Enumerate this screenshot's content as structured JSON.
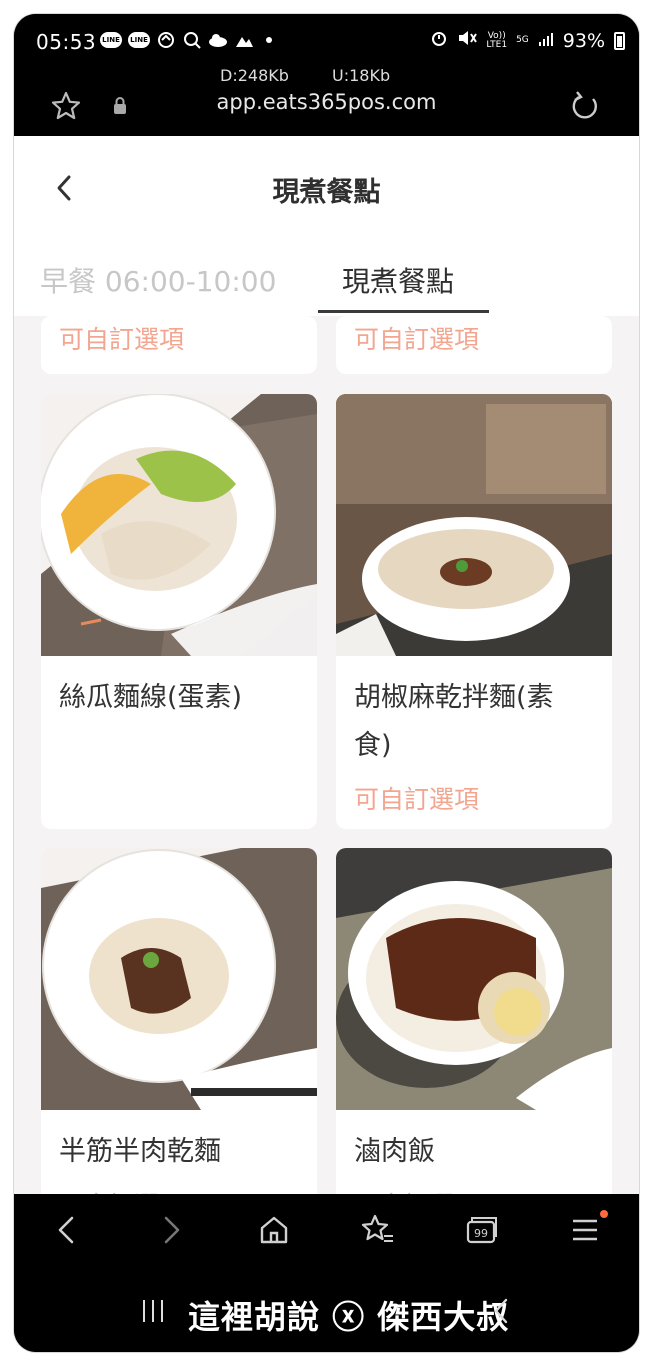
{
  "status_bar": {
    "time": "05:53",
    "notification_icons": [
      "line-icon",
      "line-icon",
      "sync-icon",
      "search-app-icon",
      "cloud-icon",
      "image-icon"
    ],
    "lte_label_top": "Vo))",
    "lte_label_bottom": "LTE1",
    "net_label": "5G",
    "battery": "93%"
  },
  "address_bar": {
    "download_speed": "D:248Kb",
    "upload_speed": "U:18Kb",
    "url": "app.eats365pos.com"
  },
  "header": {
    "title": "現煮餐點"
  },
  "tabs": [
    {
      "label": "早餐 06:00-10:00",
      "active": false
    },
    {
      "label": "現煮餐點",
      "active": true
    }
  ],
  "top_partial_cards": [
    {
      "option_label": "可自訂選項"
    },
    {
      "option_label": "可自訂選項"
    }
  ],
  "menu_items": [
    {
      "name_line1": "絲瓜麵線(蛋素)",
      "name_line2": "",
      "option_label": ""
    },
    {
      "name_line1": "胡椒麻乾拌麵(素",
      "name_line2": "食)",
      "option_label": "可自訂選項"
    },
    {
      "name_line1": "半筋半肉乾麵",
      "name_line2": "",
      "option_label": "可自訂選項"
    },
    {
      "name_line1": "滷肉飯",
      "name_line2": "",
      "option_label": "可自訂選項"
    }
  ],
  "bottom_nav": {
    "tab_count": "99"
  },
  "watermark": "這裡胡說 ⓧ 傑西大叔",
  "colors": {
    "accent": "#f2a58f",
    "page_bg": "#f5f3f4",
    "notification_dot": "#ff6b3a"
  }
}
